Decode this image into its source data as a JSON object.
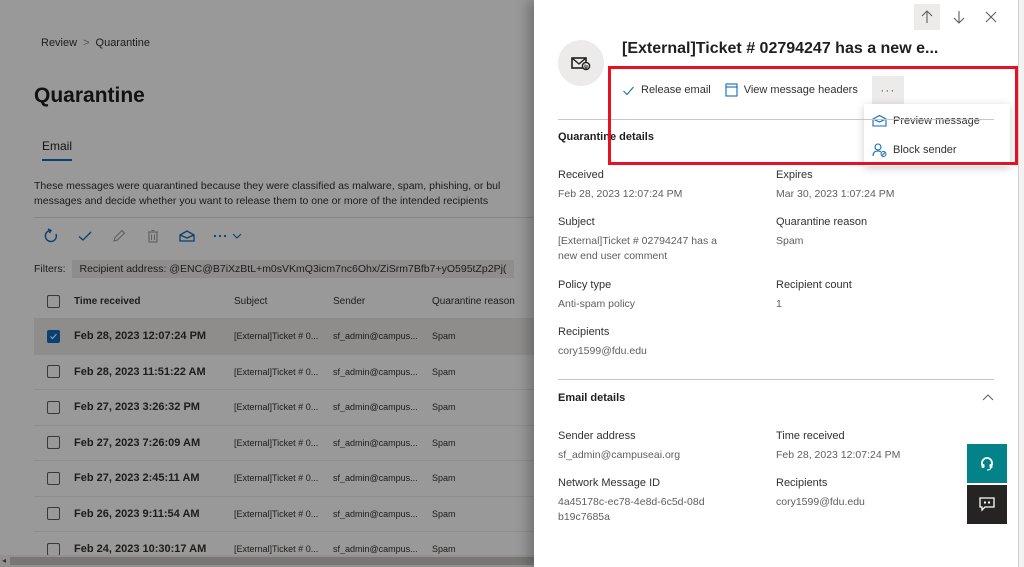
{
  "breadcrumb": {
    "items": [
      "Review",
      "Quarantine"
    ],
    "separator": ">"
  },
  "page": {
    "title": "Quarantine",
    "tab": "Email",
    "description_line1": "These messages were quarantined because they were classified as malware, spam, phishing, or bul",
    "description_line2": "messages and decide whether you want to release them to one or more of the intended recipients",
    "toolbar_icons": [
      "refresh-icon",
      "release-check-icon",
      "edit-icon",
      "delete-icon",
      "preview-envelope-icon",
      "more-icon"
    ],
    "filters_label": "Filters:",
    "filter_chip": "Recipient address: @ENC@B7iXzBtL+m0sVKmQ3icm7nc6Ohx/ZiSrm7Bfb7+yO595tZp2Pj("
  },
  "table": {
    "columns": [
      "Time received",
      "Subject",
      "Sender",
      "Quarantine reason"
    ],
    "rows": [
      {
        "time": "Feb 28, 2023 12:07:24 PM",
        "subject": "[External]Ticket # 0...",
        "sender": "sf_admin@campus...",
        "reason": "Spam",
        "selected": true
      },
      {
        "time": "Feb 28, 2023 11:51:22 AM",
        "subject": "[External]Ticket # 0...",
        "sender": "sf_admin@campus...",
        "reason": "Spam",
        "selected": false
      },
      {
        "time": "Feb 27, 2023 3:26:32 PM",
        "subject": "[External]Ticket # 0...",
        "sender": "sf_admin@campus...",
        "reason": "Spam",
        "selected": false
      },
      {
        "time": "Feb 27, 2023 7:26:09 AM",
        "subject": "[External]Ticket # 0...",
        "sender": "sf_admin@campus...",
        "reason": "Spam",
        "selected": false
      },
      {
        "time": "Feb 27, 2023 2:45:11 AM",
        "subject": "[External]Ticket # 0...",
        "sender": "sf_admin@campus...",
        "reason": "Spam",
        "selected": false
      },
      {
        "time": "Feb 26, 2023 9:11:54 AM",
        "subject": "[External]Ticket # 0...",
        "sender": "sf_admin@campus...",
        "reason": "Spam",
        "selected": false
      },
      {
        "time": "Feb 24, 2023 10:30:17 AM",
        "subject": "[External]Ticket # 0...",
        "sender": "sf_admin@campus...",
        "reason": "Spam",
        "selected": false
      }
    ]
  },
  "panel": {
    "title": "[External]Ticket # 02794247 has a new e...",
    "commands": {
      "release": "Release email",
      "headers": "View message headers",
      "more": "···"
    },
    "menu": {
      "preview": "Preview message",
      "block": "Block sender"
    },
    "quarantine_section": {
      "title": "Quarantine details",
      "fields": {
        "received": {
          "label": "Received",
          "value": "Feb 28, 2023 12:07:24 PM"
        },
        "expires": {
          "label": "Expires",
          "value": "Mar 30, 2023 1:07:24 PM"
        },
        "subject": {
          "label": "Subject",
          "value": "[External]Ticket # 02794247 has a new end user comment"
        },
        "reason": {
          "label": "Quarantine reason",
          "value": "Spam"
        },
        "policy": {
          "label": "Policy type",
          "value": "Anti-spam policy"
        },
        "count": {
          "label": "Recipient count",
          "value": "1"
        },
        "recipients": {
          "label": "Recipients",
          "value": "cory1599@fdu.edu"
        }
      }
    },
    "email_section": {
      "title": "Email details",
      "fields": {
        "sender": {
          "label": "Sender address",
          "value": "sf_admin@campuseai.org"
        },
        "time": {
          "label": "Time received",
          "value": "Feb 28, 2023 12:07:24 PM"
        },
        "netid": {
          "label": "Network Message ID",
          "value": "4a45178c-ec78-4e8d-6c5d-08db19c7685a"
        },
        "recipients": {
          "label": "Recipients",
          "value": "cory1599@fdu.edu"
        }
      }
    }
  },
  "colors": {
    "accent": "#0f6cbd",
    "highlight_box": "#e81123",
    "help_button": "#038387",
    "feedback_button": "#252423"
  }
}
